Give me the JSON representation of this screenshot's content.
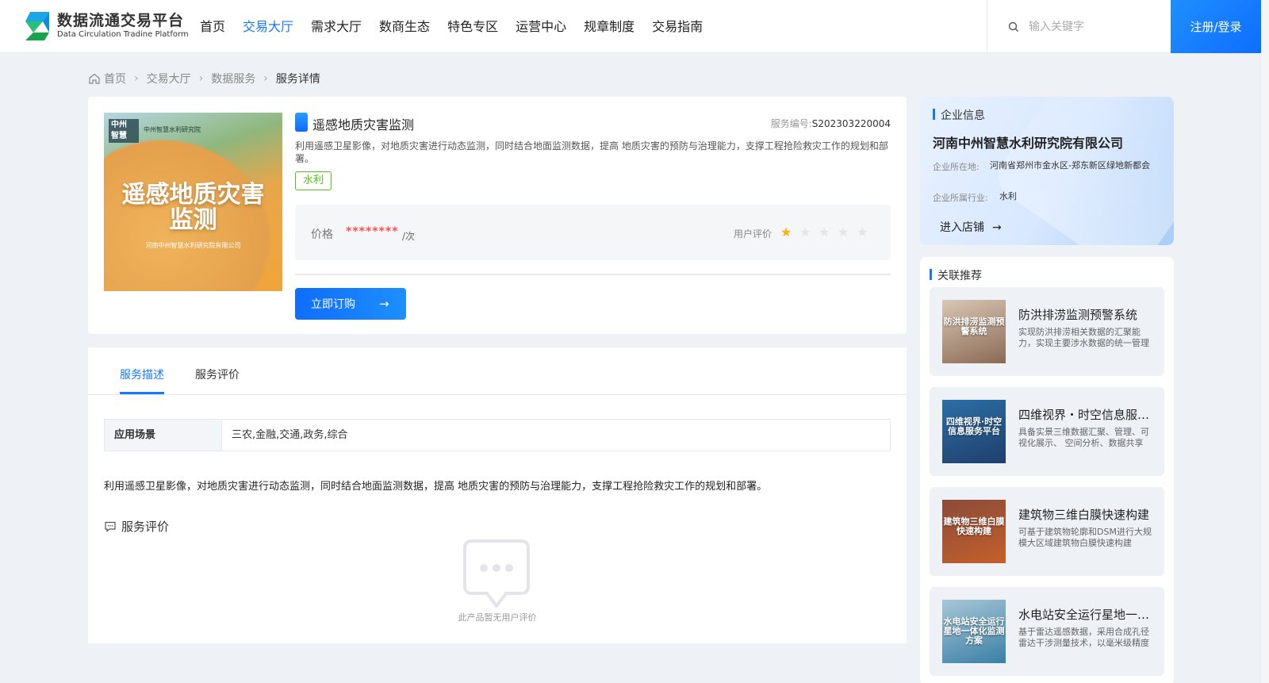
{
  "header": {
    "logo_cn": "数据流通交易平台",
    "logo_en": "Data Circulation Tradine Platform",
    "nav": [
      "首页",
      "交易大厅",
      "需求大厅",
      "数商生态",
      "特色专区",
      "运营中心",
      "规章制度",
      "交易指南"
    ],
    "active_nav": "交易大厅",
    "search_placeholder": "输入关键字",
    "login_label": "注册/登录"
  },
  "breadcrumb": [
    "首页",
    "交易大厅",
    "数据服务",
    "服务详情"
  ],
  "product": {
    "title": "遥感地质灾害监测",
    "service_no_label": "服务编号:",
    "service_no": "S202303220004",
    "description": "利用遥感卫星影像，对地质灾害进行动态监测，同时结合地面监测数据，提高 地质灾害的预防与治理能力，支撑工程抢险救灾工作的规划和部署。",
    "tag": "水利",
    "price_label": "价格",
    "price_value": "********",
    "price_unit": "/次",
    "rating_label": "用户评价",
    "rating": 1,
    "rating_max": 5,
    "buy_label": "立即订购",
    "cover": {
      "badge": "中州 智慧",
      "org": "中州智慧水利研究院",
      "title_line1": "遥感地质灾害",
      "title_line2": "监测",
      "subtitle": "河南中州智慧水利研究院有限公司"
    }
  },
  "tabs": [
    "服务描述",
    "服务评价"
  ],
  "active_tab": "服务描述",
  "detail": {
    "scene_label": "应用场景",
    "scene_value": "三农,金融,交通,政务,综合",
    "long_description": "利用遥感卫星影像，对地质灾害进行动态监测，同时结合地面监测数据，提高 地质灾害的预防与治理能力，支撑工程抢险救灾工作的规划和部署。",
    "review_title": "服务评价",
    "empty_text": "此产品暂无用户评价"
  },
  "company": {
    "section_title": "企业信息",
    "name": "河南中州智慧水利研究院有限公司",
    "location_label": "企业所在地:",
    "location": "河南省郑州市金水区-郑东新区绿地新都会",
    "industry_label": "企业所属行业:",
    "industry": "水利",
    "enter_label": "进入店铺"
  },
  "recommend": {
    "section_title": "关联推荐",
    "items": [
      {
        "name": "防洪排涝监测预警系统",
        "desc": "实现防洪排涝相关数据的汇聚能力，实现主要涉水数据的统一管理",
        "thumb_text": "防洪排涝监测预警系统",
        "colors": [
          "#8a6a55",
          "#d9c7b5"
        ]
      },
      {
        "name": "四维视界・时空信息服务平台",
        "desc": "具备实景三维数据汇聚、管理、可视化展示、 空间分析、数据共享",
        "thumb_text": "四维视界·时空信息服务平台",
        "colors": [
          "#1f3f6b",
          "#2c6fa6"
        ]
      },
      {
        "name": "建筑物三维白膜快速构建",
        "desc": "可基于建筑物轮廓和DSM进行大规模大区域建筑物白膜快速构建",
        "thumb_text": "建筑物三维白膜快速构建",
        "colors": [
          "#c4602a",
          "#8a4b3a"
        ]
      },
      {
        "name": "水电站安全运行星地一体化监测方案",
        "desc": "基于雷达遥感数据，采用合成孔径雷达干涉测量技术，以毫米级精度",
        "thumb_text": "水电站安全运行星地一体化监测方案",
        "colors": [
          "#3a7fa6",
          "#a7c7d6"
        ]
      }
    ]
  }
}
